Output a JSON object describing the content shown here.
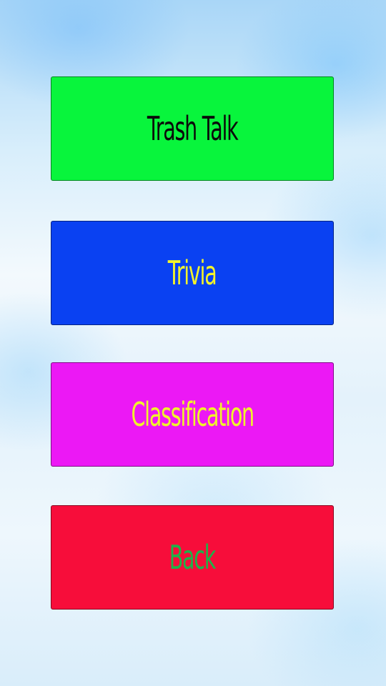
{
  "menu": {
    "buttons": [
      {
        "label": "Trash Talk",
        "bg": "#08f53c",
        "fg": "#0b0b0b"
      },
      {
        "label": "Trivia",
        "bg": "#0a41f2",
        "fg": "#f3f32a"
      },
      {
        "label": "Classification",
        "bg": "#ec18f5",
        "fg": "#f0f52a"
      },
      {
        "label": "Back",
        "bg": "#f70d3a",
        "fg": "#1fb24a"
      }
    ]
  }
}
